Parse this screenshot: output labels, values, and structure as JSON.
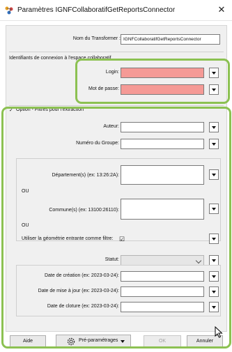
{
  "window": {
    "title": "Paramètres IGNFCollaboratifGetReportsConnector",
    "close_glyph": "✕"
  },
  "transformer": {
    "label": "Nom du Transformer :",
    "value": "IGNFCollaboratifGetReportsConnector"
  },
  "connection": {
    "section_label": "Identifiants de connexion à l'espace collaboratif",
    "login_label": "Login:",
    "login_value": "",
    "password_label": "Mot de passe:",
    "password_value": ""
  },
  "filters": {
    "section_label": "Option - Filtres pour l'extraction",
    "section_prefix": "✓",
    "auteur_label": "Auteur:",
    "groupe_label": "Numéro du Groupe:",
    "departements_label": "Département(s) (ex: 13:26:2A):",
    "ou1": "OU",
    "communes_label": "Commune(s) (ex: 13100:26110):",
    "ou2": "OU",
    "geometrie_label": "Utiliser la géométrie entrante comme filtre:",
    "geometrie_checked": "☑",
    "statut_label": "Statut:",
    "date_creation_label": "Date de création (ex: 2023-03-24):",
    "date_maj_label": "Date de mise à jour (ex: 2023-03-24):",
    "date_cloture_label": "Date de cloture (ex: 2023-03-24):"
  },
  "footer": {
    "aide": "Aide",
    "preparametrages": "Pré-paramétrages",
    "ok": "OK",
    "annuler": "Annuler"
  },
  "colors": {
    "highlight_green": "#8cc152",
    "required_pink": "#f59a96"
  },
  "icons": {
    "app": "fme-transformer-icon",
    "settings": "gear-icon",
    "cursor": "mouse-pointer-icon"
  }
}
